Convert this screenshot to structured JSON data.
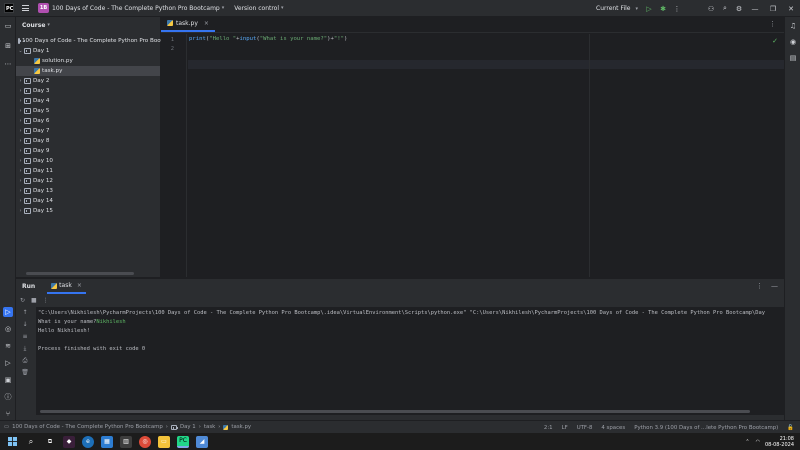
{
  "titlebar": {
    "project_badge": "1B",
    "project_name": "100 Days of Code - The Complete Python Pro Bootcamp",
    "version_control": "Version control",
    "run_config": "Current File"
  },
  "project_panel": {
    "title": "Course",
    "root": "100 Days of Code - The Complete Python Pro Bootcamp",
    "day1": "Day 1",
    "files": [
      "solution.py",
      "task.py"
    ],
    "days": [
      "Day 2",
      "Day 3",
      "Day 4",
      "Day 5",
      "Day 6",
      "Day 7",
      "Day 8",
      "Day 9",
      "Day 10",
      "Day 11",
      "Day 12",
      "Day 13",
      "Day 14",
      "Day 15"
    ]
  },
  "editor": {
    "tab": "task.py",
    "line_numbers": [
      "1",
      "2"
    ],
    "code": {
      "fn": "print",
      "open": "(",
      "str1": "\"Hello \"",
      "plus1": "+",
      "fn2": "input",
      "open2": "(",
      "str2": "\"What is your name?\"",
      "close2": ")",
      "plus2": "+",
      "str3": "\"!\"",
      "close": ")"
    }
  },
  "run_panel": {
    "title": "Run",
    "tab": "task",
    "console": {
      "line1": "\"C:\\Users\\Nikhilesh\\PycharmProjects\\100 Days of Code - The Complete Python Pro Bootcamp\\.idea\\VirtualEnvironment\\Scripts\\python.exe\" \"C:\\Users\\Nikhilesh\\PycharmProjects\\100 Days of Code - The Complete Python Pro Bootcamp\\Day",
      "prompt": "What is your name?",
      "input": "Nikhilesh",
      "line3": "Hello Nikhilesh!",
      "line5": "Process finished with exit code 0"
    }
  },
  "statusbar": {
    "breadcrumb": [
      "100 Days of Code - The Complete Python Pro Bootcamp",
      "Day 1",
      "task",
      "task.py"
    ],
    "position": "2:1",
    "line_sep": "LF",
    "encoding": "UTF-8",
    "indent": "4 spaces",
    "interpreter": "Python 3.9 (100 Days of ...lete Python Pro Bootcamp)"
  },
  "taskbar": {
    "time": "21:08",
    "date": "08-08-2024"
  }
}
